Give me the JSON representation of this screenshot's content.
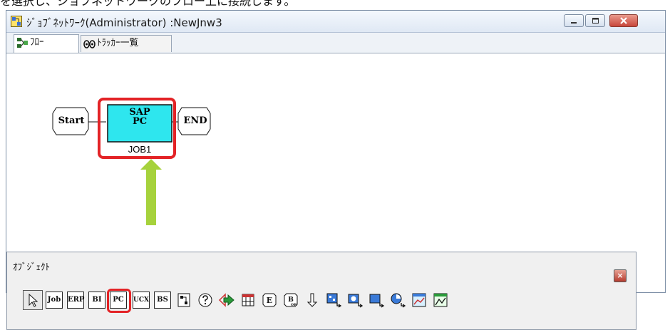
{
  "caption": "を選択し、ジョブネットワークのフロー上に接続します。",
  "window": {
    "title": "ｼﾞｮﾌﾞﾈｯﾄﾜｰｸ(Administrator) :NewJnw3"
  },
  "tabs": [
    {
      "label": "ﾌﾛｰ"
    },
    {
      "label": "ﾄﾗｯｶｰ一覧"
    }
  ],
  "flow": {
    "start_label": "Start",
    "end_label": "END",
    "job": {
      "icon_line1": "SAP",
      "icon_line2": "PC",
      "name": "JOB1"
    }
  },
  "object_panel": {
    "title": "ｵﾌﾞｼﾞｪｸﾄ",
    "close_glyph": "×",
    "tools": {
      "job": "Job",
      "erp": "ERP",
      "bi": "BI",
      "pc": "PC",
      "ucx": "UCX",
      "bs": "BS"
    }
  },
  "colors": {
    "highlight": "#e32326",
    "arrow": "#a6d23c",
    "job_fill": "#2ee6ee"
  }
}
